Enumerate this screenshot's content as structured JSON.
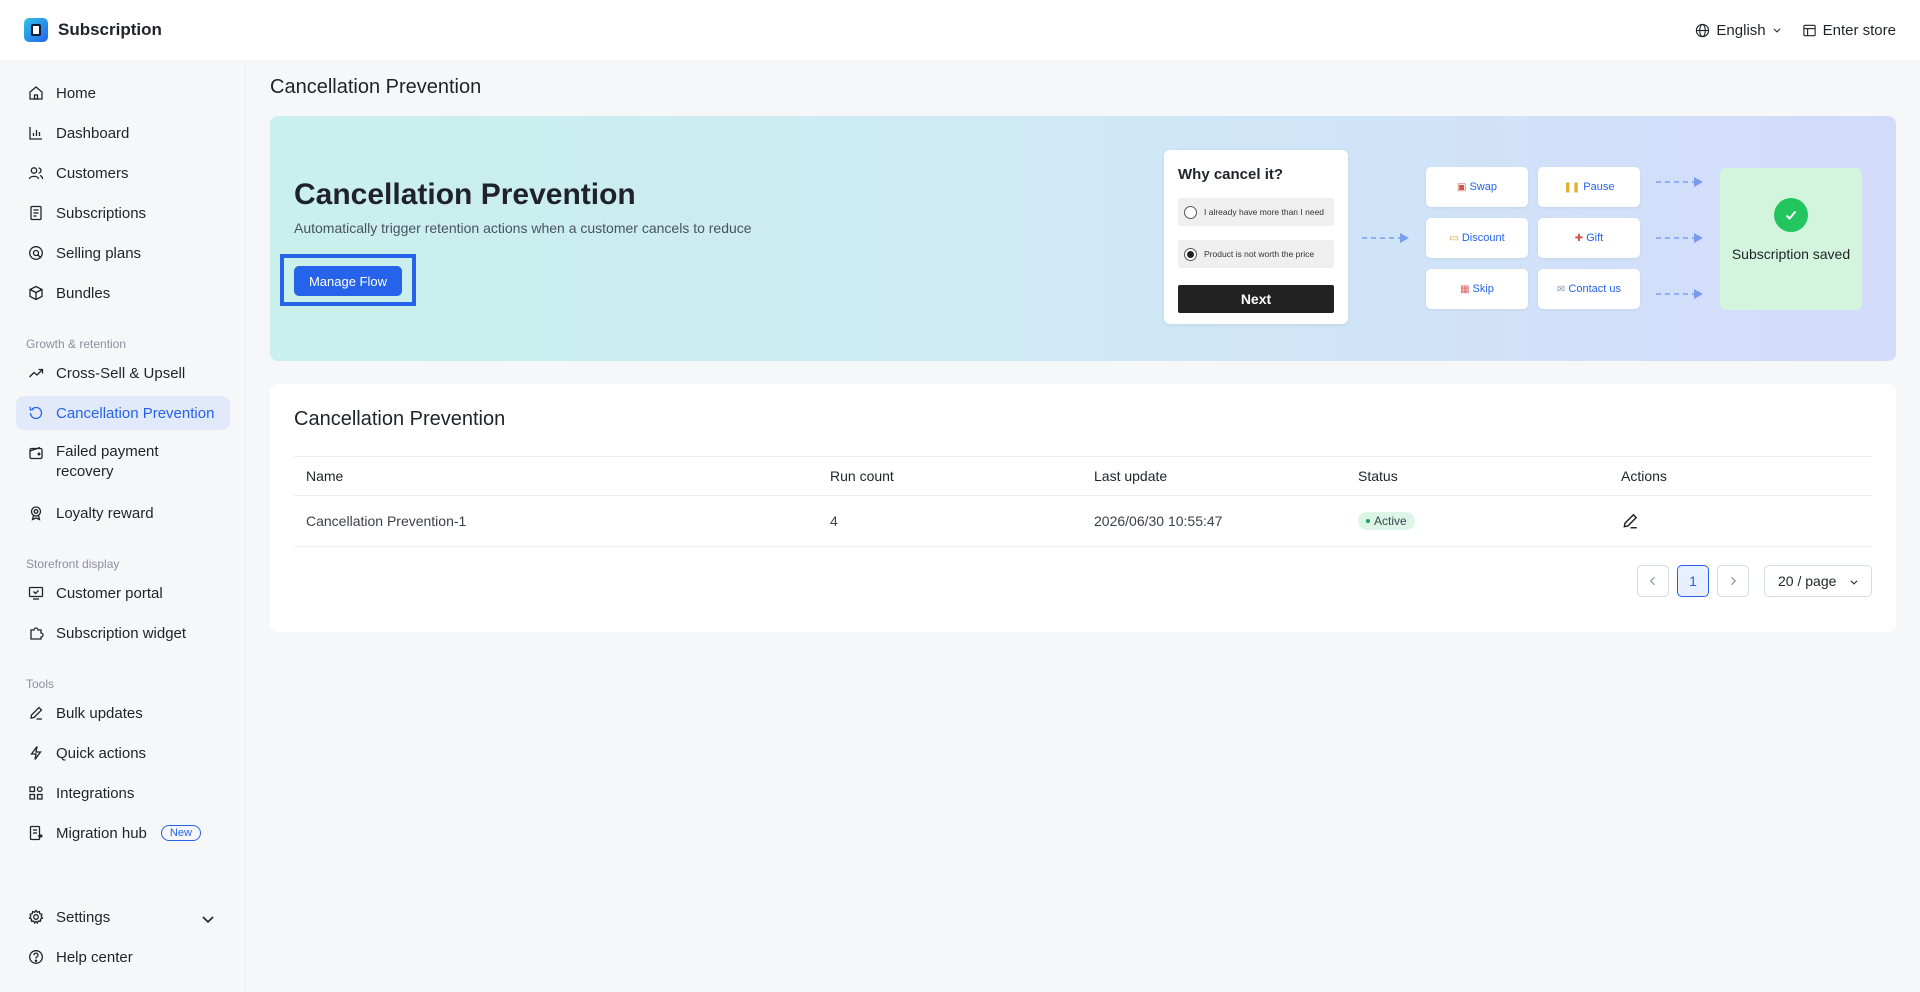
{
  "app": {
    "title": "Subscription"
  },
  "topbar": {
    "language": "English",
    "enter_store": "Enter store"
  },
  "sidebar": {
    "items": [
      {
        "label": "Home",
        "icon": "home-icon"
      },
      {
        "label": "Dashboard",
        "icon": "chart-icon"
      },
      {
        "label": "Customers",
        "icon": "users-icon"
      },
      {
        "label": "Subscriptions",
        "icon": "document-icon"
      },
      {
        "label": "Selling plans",
        "icon": "tag-icon"
      },
      {
        "label": "Bundles",
        "icon": "box-icon"
      }
    ],
    "section_growth": "Growth & retention",
    "growth_items": [
      {
        "label": "Cross-Sell & Upsell",
        "icon": "trend-up-icon"
      },
      {
        "label": "Cancellation Prevention",
        "icon": "refresh-icon",
        "active": true
      },
      {
        "label": "Failed payment recovery",
        "icon": "wallet-icon"
      },
      {
        "label": "Loyalty reward",
        "icon": "award-icon"
      }
    ],
    "section_storefront": "Storefront display",
    "storefront_items": [
      {
        "label": "Customer portal",
        "icon": "monitor-icon"
      },
      {
        "label": "Subscription widget",
        "icon": "puzzle-icon"
      }
    ],
    "section_tools": "Tools",
    "tools_items": [
      {
        "label": "Bulk updates",
        "icon": "edit-icon"
      },
      {
        "label": "Quick actions",
        "icon": "bolt-icon"
      },
      {
        "label": "Integrations",
        "icon": "grid-icon"
      },
      {
        "label": "Migration hub",
        "icon": "migrate-icon",
        "badge": "New"
      }
    ],
    "settings": "Settings",
    "help": "Help center"
  },
  "page": {
    "title": "Cancellation Prevention"
  },
  "banner": {
    "title": "Cancellation Prevention",
    "subtitle": "Automatically trigger retention actions when a customer cancels to reduce",
    "button": "Manage Flow",
    "card_title": "Why cancel it?",
    "options": [
      "I already have more than I need",
      "Product is not worth the price"
    ],
    "next": "Next",
    "actions": [
      "Swap",
      "Pause",
      "Discount",
      "Gift",
      "Skip",
      "Contact us"
    ],
    "saved": "Subscription saved"
  },
  "table": {
    "title": "Cancellation Prevention",
    "columns": [
      "Name",
      "Run count",
      "Last update",
      "Status",
      "Actions"
    ],
    "rows": [
      {
        "name": "Cancellation Prevention-1",
        "run_count": "4",
        "last_update": "2026/06/30 10:55:47",
        "status": "Active"
      }
    ],
    "page": "1",
    "page_size": "20 / page"
  }
}
